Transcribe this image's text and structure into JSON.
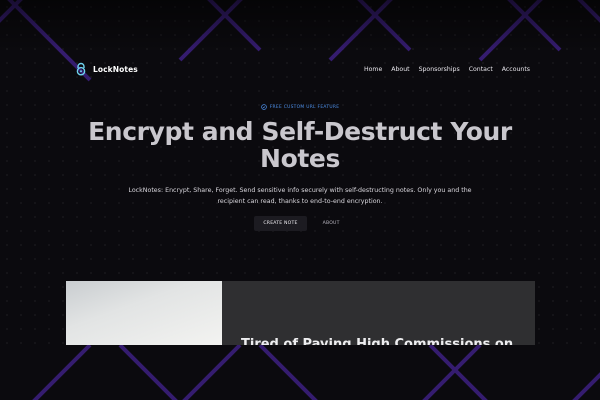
{
  "app": {
    "name": "LockNotes"
  },
  "nav": {
    "items": [
      "Home",
      "About",
      "Sponsorships",
      "Contact",
      "Accounts"
    ]
  },
  "hero": {
    "badge": "FREE CUSTOM URL FEATURE",
    "title": "Encrypt and Self-Destruct Your Notes",
    "subtitle": "LockNotes: Encrypt, Share, Forget. Send sensitive info securely with self-destructing notes. Only you and the recipient can read, thanks to end-to-end encryption.",
    "primary_cta": "CREATE NOTE",
    "secondary_cta": "ABOUT"
  },
  "promo": {
    "heading": "Tired of Paying High Commissions on"
  },
  "colors": {
    "accent": "#4d8fe8",
    "stripe": "#3a1f7a",
    "background": "#0b0a0e",
    "card": "#2f2f31"
  },
  "icons": {
    "logo": "lock-logo-icon",
    "badge": "shield-check-icon"
  }
}
